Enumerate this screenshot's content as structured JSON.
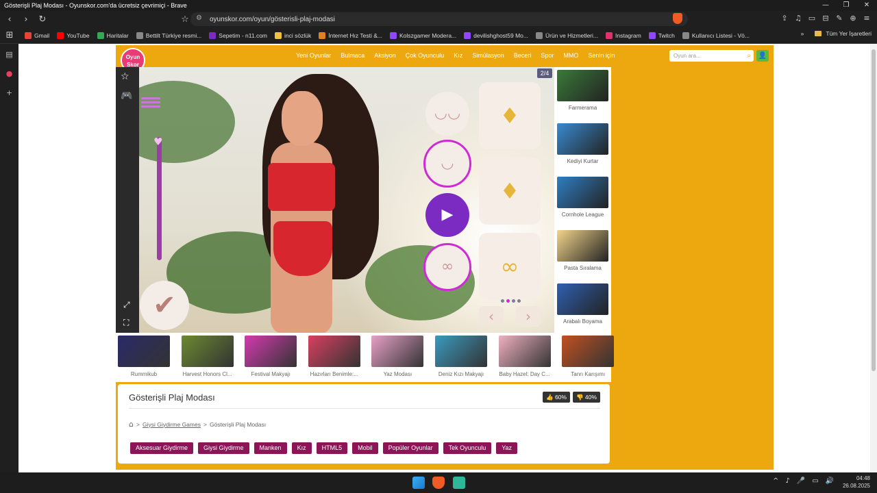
{
  "window": {
    "title": "Gösterişli Plaj Modası - Oyunskor.com'da ücretsiz çevrimiçi - Brave",
    "controls": [
      "—",
      "❐",
      "✕"
    ]
  },
  "browser": {
    "url": "oyunskor.com/oyun/gösterisli-plaj-modasi",
    "nav_icons": [
      "‹",
      "›",
      "↻"
    ],
    "bookmark_star": "☆",
    "right_icons": [
      "⇪",
      "♫",
      "▭",
      "⊟",
      "✎",
      "⊕",
      "≡"
    ]
  },
  "bookmarks": [
    {
      "label": "Gmail",
      "color": "#ea4335"
    },
    {
      "label": "YouTube",
      "color": "#ff0000"
    },
    {
      "label": "Haritalar",
      "color": "#34a853"
    },
    {
      "label": "Bettilt Türkiye resmi...",
      "color": "#888888"
    },
    {
      "label": "Sepetim - n11.com",
      "color": "#7b2bc2"
    },
    {
      "label": "inci sözlük",
      "color": "#f0c040"
    },
    {
      "label": "İnternet Hız Testi &...",
      "color": "#e08020"
    },
    {
      "label": "Kolszgamer Modera...",
      "color": "#9146ff"
    },
    {
      "label": "devilishghost59 Mo...",
      "color": "#9146ff"
    },
    {
      "label": "Ürün ve Hizmetleri...",
      "color": "#888888"
    },
    {
      "label": "Instagram",
      "color": "#e1306c"
    },
    {
      "label": "Twitch",
      "color": "#9146ff"
    },
    {
      "label": "Kullanıcı Listesi - Vö...",
      "color": "#888888"
    }
  ],
  "bookmarks_more": "»",
  "bookmarks_folder": "Tüm Yer İşaretleri",
  "sidebar_icons": [
    "▤",
    "●",
    "+"
  ],
  "site": {
    "logo_line1": "Oyun",
    "logo_line2": "Skor",
    "nav": [
      "Yeni Oyunlar",
      "Bulmaca",
      "Aksiyon",
      "Çok Oyunculu",
      "Kız",
      "Simülasyon",
      "Beceri",
      "Spor",
      "MMO",
      "Senin için"
    ],
    "search_placeholder": "Oyun ara...",
    "search_icon": "⌕",
    "user_icon": "👤",
    "accent": "#eda80f"
  },
  "game": {
    "page_indicator": "2/4",
    "left_icons": [
      "☆",
      "🎮"
    ],
    "check": "✔",
    "expand_icons": [
      "⤢",
      "⛶"
    ],
    "options": [
      "◡◡",
      "◡",
      "▶",
      "∞"
    ],
    "accessories": [
      "♦",
      "♦",
      "∞"
    ],
    "arrows": [
      "‹",
      "›"
    ]
  },
  "right_games": [
    {
      "label": "Farmerama",
      "color": "#3a7a3a"
    },
    {
      "label": "Kediyi Kurtar",
      "color": "#3a8ad0"
    },
    {
      "label": "Cornhole League",
      "color": "#2f7ec2"
    },
    {
      "label": "Pasta Sıralama",
      "color": "#f2d48a"
    },
    {
      "label": "Arabalı Boyama",
      "color": "#2f5fb0"
    }
  ],
  "bottom_games": [
    {
      "label": "Rummikub",
      "color": "#2a2a6a"
    },
    {
      "label": "Harvest Honors Cl...",
      "color": "#6a8a30"
    },
    {
      "label": "Festival Makyajı",
      "color": "#d43ab0"
    },
    {
      "label": "Hazırları Benimle:...",
      "color": "#d84060"
    },
    {
      "label": "Yaz Modası",
      "color": "#e8a0c8"
    },
    {
      "label": "Deniz Kızı Makyajı",
      "color": "#3a9ac0"
    },
    {
      "label": "Baby Hazel: Day C...",
      "color": "#f0b0c0"
    },
    {
      "label": "Tanrı Karışımı",
      "color": "#c05020"
    }
  ],
  "info": {
    "title": "Gösterişli Plaj Modası",
    "likes": "👍 60%",
    "dislikes": "👎 40%",
    "breadcrumb_home": "⌂",
    "breadcrumb_link": "Giysi Giydirme Games",
    "breadcrumb_current": "Gösterişli Plaj Modası",
    "separator": ">",
    "tags": [
      "Aksesuar Giydirme",
      "Giysi Giydirme",
      "Manken",
      "Kız",
      "HTML5",
      "Mobil",
      "Popüler Oyunlar",
      "Tek Oyunculu",
      "Yaz"
    ]
  },
  "taskbar": {
    "time": "04:48",
    "date": "26.08.2025",
    "tray_icons": [
      "^",
      "♪",
      "🎤",
      "▭",
      "🔊"
    ]
  }
}
